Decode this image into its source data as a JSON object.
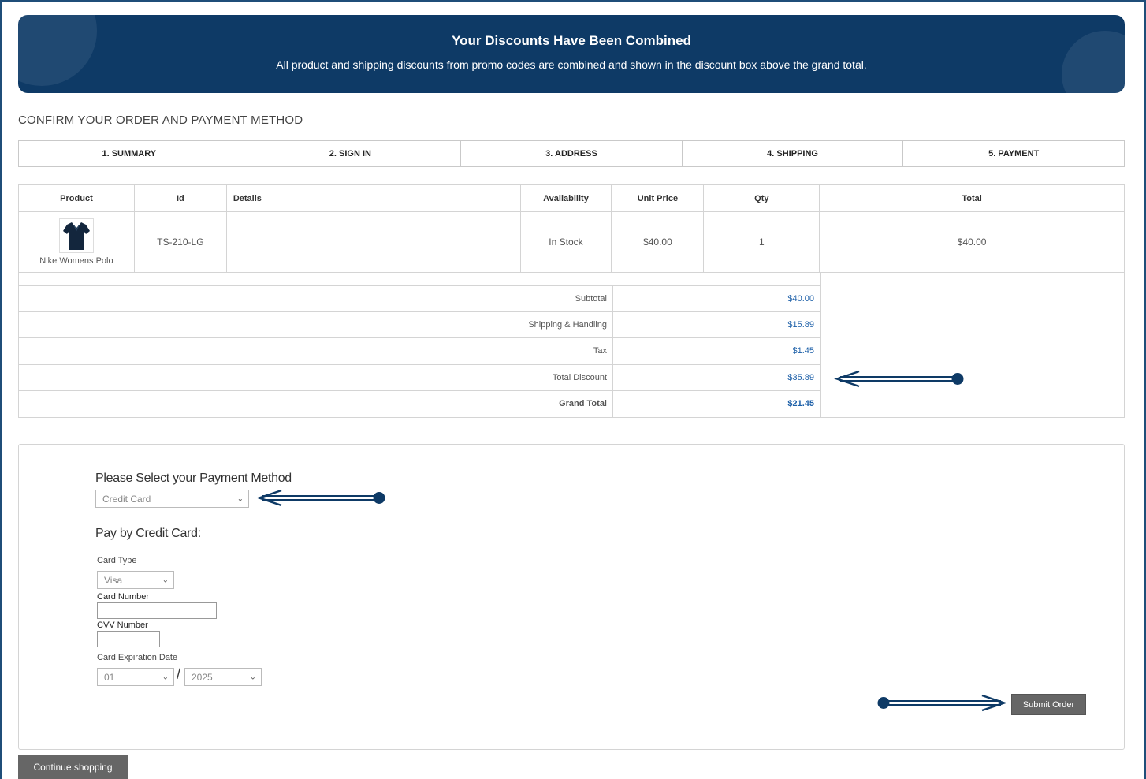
{
  "banner": {
    "title": "Your Discounts Have Been Combined",
    "subtitle": "All product and shipping discounts from promo codes are combined and shown in the discount box above the grand total."
  },
  "page_heading": "CONFIRM YOUR ORDER AND PAYMENT METHOD",
  "steps": [
    "1. SUMMARY",
    "2. SIGN IN",
    "3. ADDRESS",
    "4. SHIPPING",
    "5. PAYMENT"
  ],
  "table": {
    "headers": {
      "product": "Product",
      "id": "Id",
      "details": "Details",
      "availability": "Availability",
      "unit_price": "Unit Price",
      "qty": "Qty",
      "total": "Total"
    },
    "row": {
      "product": "Nike Womens Polo",
      "id": "TS-210-LG",
      "details": "",
      "availability": "In Stock",
      "unit_price": "$40.00",
      "qty": "1",
      "total": "$40.00"
    }
  },
  "summary": {
    "subtotal_label": "Subtotal",
    "subtotal": "$40.00",
    "shipping_label": "Shipping & Handling",
    "shipping": "$15.89",
    "tax_label": "Tax",
    "tax": "$1.45",
    "discount_label": "Total Discount",
    "discount": "$35.89",
    "grand_label": "Grand Total",
    "grand": "$21.45"
  },
  "payment": {
    "method_title": "Please Select your Payment Method",
    "method_value": "Credit Card",
    "pay_title": "Pay by Credit Card:",
    "card_type_label": "Card Type",
    "card_type_value": "Visa",
    "card_number_label": "Card Number",
    "cvv_label": "CVV Number",
    "expiry_label": "Card Expiration Date",
    "expiry_month": "01",
    "expiry_separator": "/",
    "expiry_year": "2025",
    "submit_label": "Submit Order"
  },
  "continue_label": "Continue shopping",
  "colors": {
    "banner": "#0e3a66",
    "accent_blue": "#1c5fa8",
    "arrow": "#0e3a66",
    "button": "#666666"
  }
}
